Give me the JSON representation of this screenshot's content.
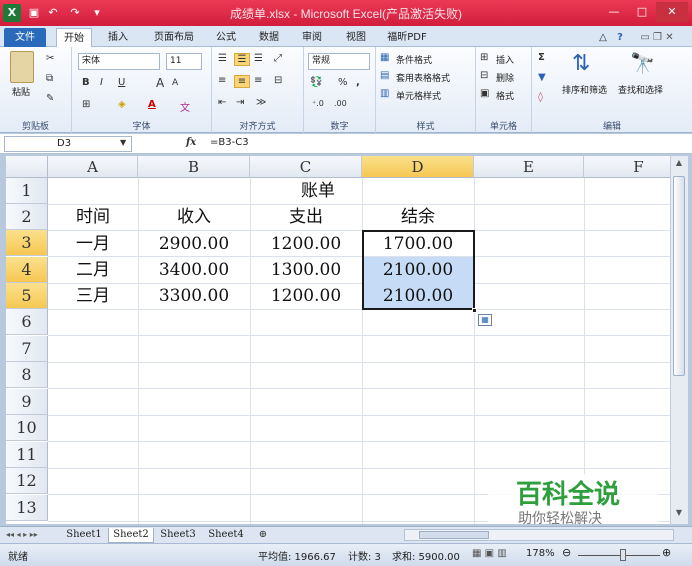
{
  "window": {
    "title": "成绩单.xlsx - Microsoft Excel(产品激活失败)",
    "app_icon": "excel-icon",
    "accent_color": "#d9253f"
  },
  "tabs": {
    "file": "文件",
    "items": [
      "开始",
      "插入",
      "页面布局",
      "公式",
      "数据",
      "审阅",
      "视图",
      "福昕PDF"
    ],
    "active": "开始"
  },
  "ribbon": {
    "clipboard": {
      "label": "剪贴板",
      "paste": "粘贴"
    },
    "font": {
      "label": "字体",
      "name": "宋体",
      "size": "11",
      "bold": "B",
      "italic": "I",
      "underline": "U",
      "grow": "A",
      "shrink": "A",
      "wen": "文",
      "color_a": "A"
    },
    "alignment": {
      "label": "对齐方式"
    },
    "number": {
      "label": "数字",
      "format": "常规",
      "percent": "%",
      "comma": ","
    },
    "styles": {
      "label": "样式",
      "conditional": "条件格式",
      "table": "套用表格格式",
      "cell": "单元格样式"
    },
    "cells": {
      "label": "单元格",
      "insert": "插入",
      "delete": "删除",
      "format": "格式"
    },
    "editing": {
      "label": "编辑",
      "sum": "Σ",
      "sort": "排序和筛选",
      "find": "查找和选择"
    }
  },
  "formula_bar": {
    "name_box": "D3",
    "fx": "fx",
    "formula": "=B3-C3"
  },
  "grid": {
    "columns": [
      "A",
      "B",
      "C",
      "D",
      "E",
      "F"
    ],
    "rows": [
      "1",
      "2",
      "3",
      "4",
      "5",
      "6",
      "7",
      "8",
      "9",
      "10",
      "11",
      "12",
      "13"
    ],
    "cells": {
      "title": "账单",
      "h_time": "时间",
      "h_income": "收入",
      "h_expense": "支出",
      "h_balance": "结余",
      "r3": [
        "一月",
        "2900.00",
        "1200.00",
        "1700.00"
      ],
      "r4": [
        "二月",
        "3400.00",
        "1300.00",
        "2100.00"
      ],
      "r5": [
        "三月",
        "3300.00",
        "1200.00",
        "2100.00"
      ]
    }
  },
  "sheets": [
    "Sheet1",
    "Sheet2",
    "Sheet3",
    "Sheet4"
  ],
  "active_sheet": "Sheet2",
  "status": {
    "mode": "就绪",
    "average": "平均值: 1966.67",
    "count": "计数: 3",
    "sum": "求和: 5900.00",
    "zoom": "178%"
  },
  "watermark": {
    "title": "百科全说",
    "subtitle": "助你轻松解决"
  }
}
